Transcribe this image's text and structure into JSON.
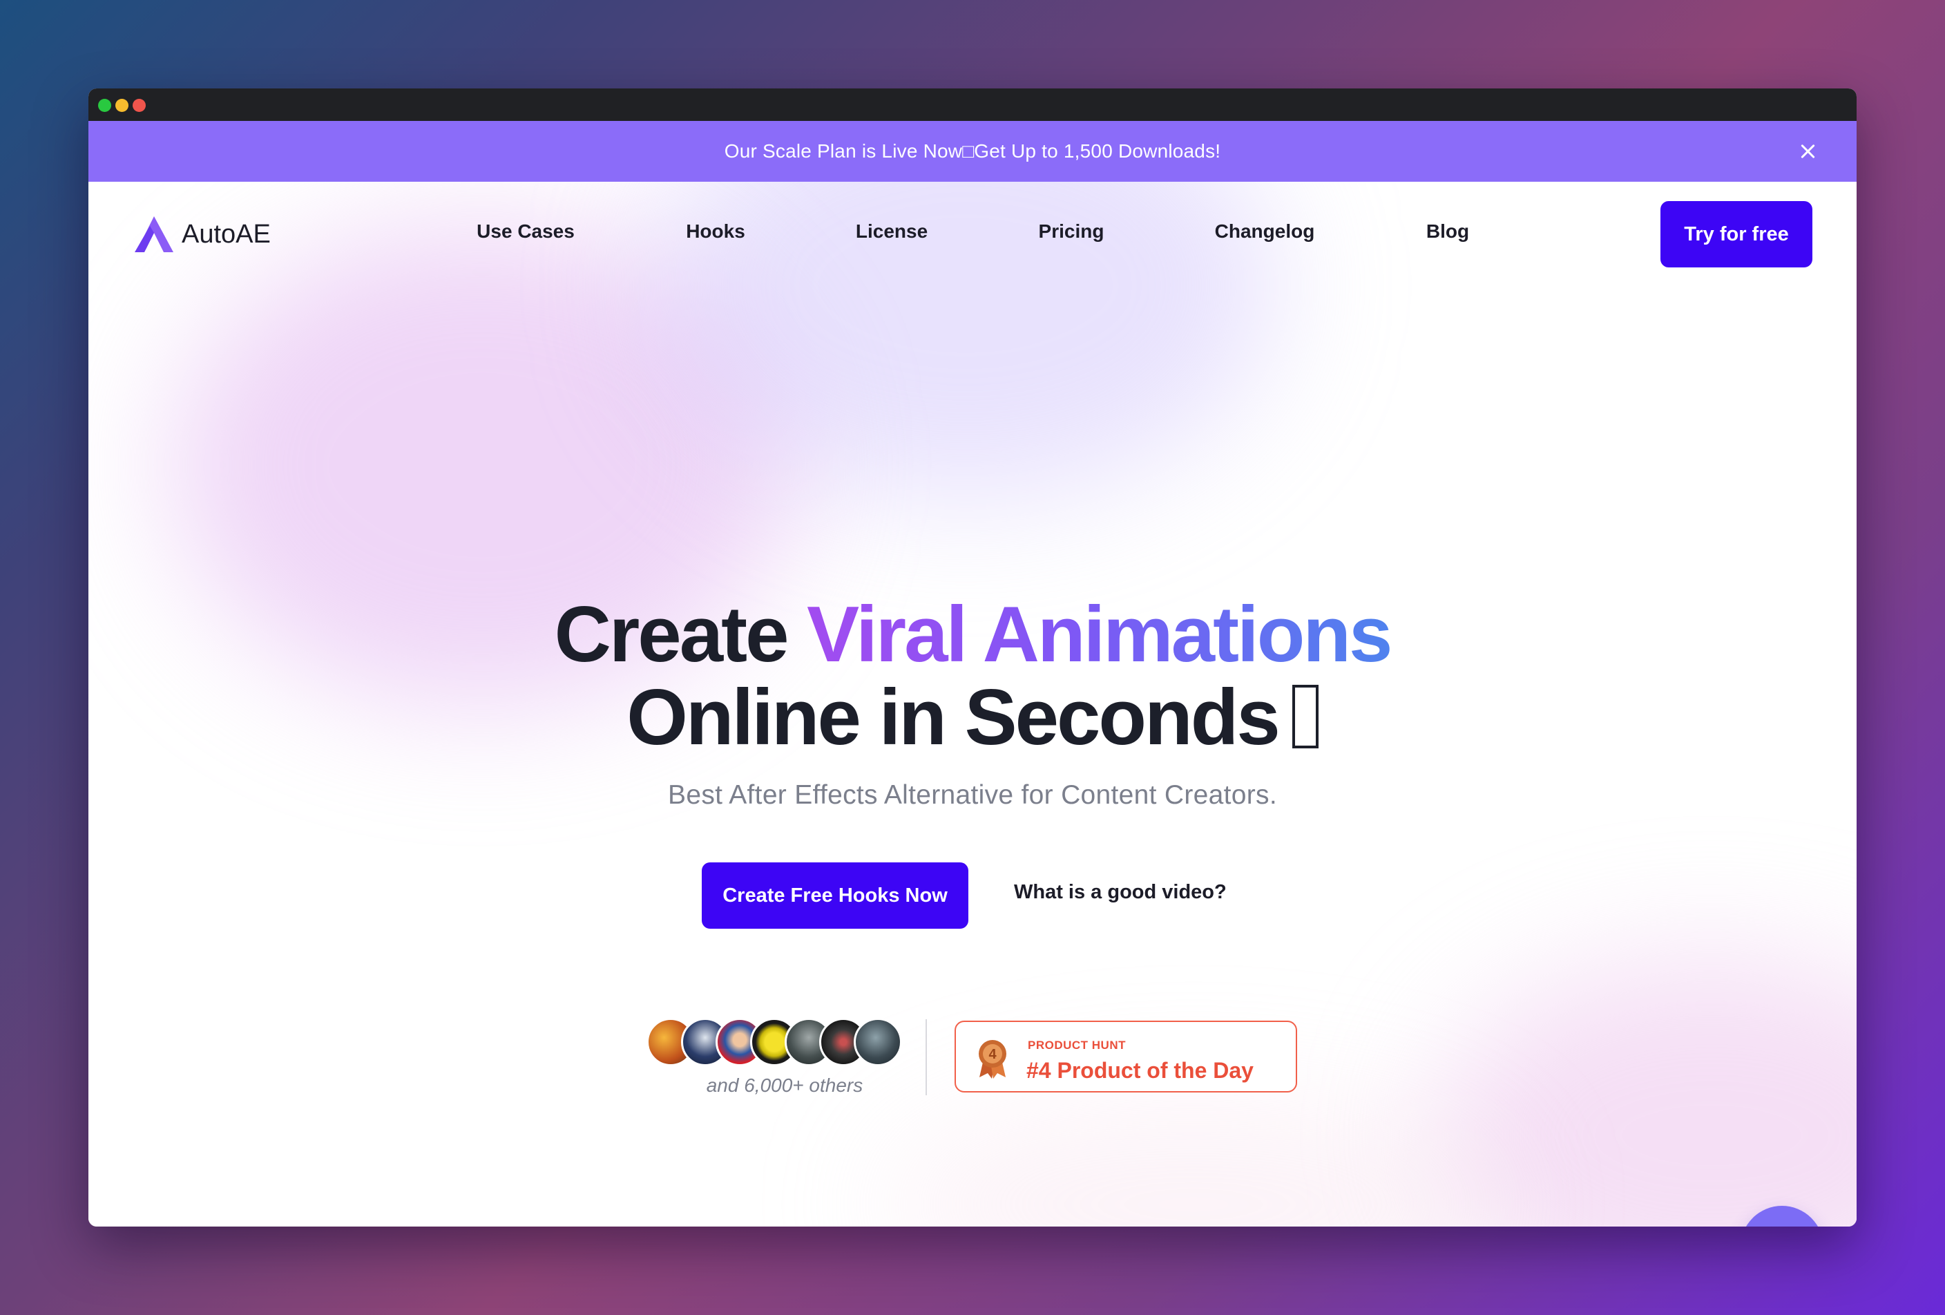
{
  "announcement": {
    "text": "Our Scale Plan is Live Now□Get Up to 1,500 Downloads!"
  },
  "brand": {
    "name": "AutoAE",
    "accent_color": "#8b5cf6",
    "button_color": "#3d05f5"
  },
  "nav": {
    "links": [
      "Use Cases",
      "Hooks",
      "License",
      "Pricing",
      "Changelog",
      "Blog"
    ],
    "cta_label": "Try for free"
  },
  "hero": {
    "headline_prefix": "Create ",
    "headline_highlight": "Viral Animations",
    "headline_line2": "Online in Seconds",
    "subheadline": "Best After Effects Alternative for Content Creators.",
    "primary_cta": "Create Free Hooks Now",
    "secondary_cta": "What is a good video?"
  },
  "social_proof": {
    "others_text": "and 6,000+ others"
  },
  "product_hunt": {
    "label": "PRODUCT HUNT",
    "title": "#4 Product of the Day",
    "medal_number": "4",
    "color": "#ea4f3a"
  },
  "icons": {
    "close": "close-icon",
    "chat": "chat-bubble-icon",
    "medal": "medal-icon"
  }
}
